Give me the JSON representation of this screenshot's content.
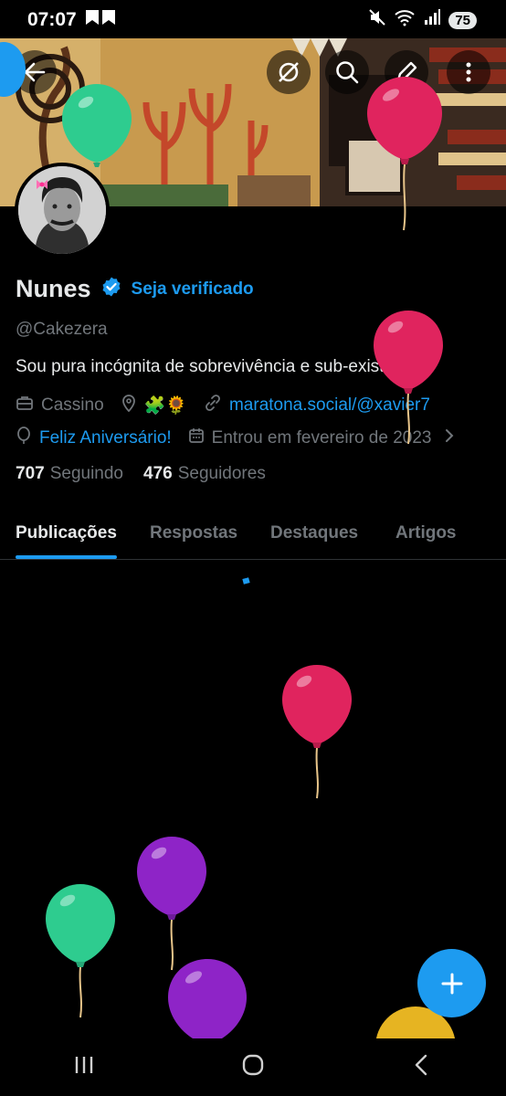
{
  "status_bar": {
    "time": "07:07",
    "battery": "75"
  },
  "profile": {
    "name": "Nunes",
    "verify_link": "Seja verificado",
    "handle": "@Cakezera",
    "bio": "Sou pura incógnita de sobrevivência e sub-existência",
    "category": "Cassino",
    "location_emoji": "🧩🌻",
    "website": "maratona.social/@xavier7",
    "birthday": "Feliz Aniversário!",
    "joined": "Entrou em fevereiro de 2023",
    "following_count": "707",
    "following_label": "Seguindo",
    "followers_count": "476",
    "followers_label": "Seguidores"
  },
  "tabs": [
    "Publicações",
    "Respostas",
    "Destaques",
    "Artigos"
  ],
  "colors": {
    "accent": "#1d9bf0",
    "balloon_red": "#e0245e",
    "balloon_green": "#2ecc8f",
    "balloon_purple": "#8e24c7",
    "balloon_yellow": "#e6b422"
  }
}
